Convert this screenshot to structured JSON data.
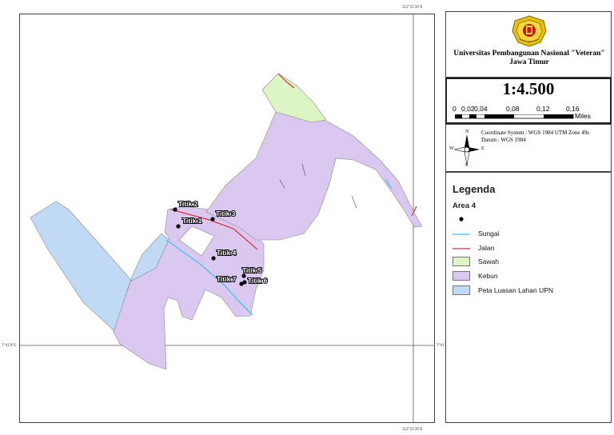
{
  "map": {
    "grat_top": "112°21'30\"E",
    "grat_bottom": "112°21'30\"E",
    "grat_left": "7°41'0\"S",
    "grat_right": "7°41'0\"S",
    "points": [
      "Titik 2",
      "Titik 1",
      "Titik 3",
      "Titik 4",
      "Titik 5",
      "Titik 7",
      "Titik 6"
    ],
    "colors": {
      "kebun": "#dac8f0",
      "sawah": "#ddf4c4",
      "lahan": "#c0d9f5",
      "sungai": "#3ec3e8",
      "jalan": "#d83030"
    }
  },
  "header": {
    "logo": "upn-logo-icon",
    "title_line1": "Universitas Pembangunan Nasional \"Veteran\"",
    "title_line2": "Jawa Timur"
  },
  "scale": {
    "ratio": "1:4.500",
    "ticks": [
      "0",
      "0,02",
      "0,04",
      "0,08",
      "0,12",
      "0,16"
    ],
    "unit": "Miles"
  },
  "info": {
    "north_arrow": "compass-icon",
    "compass_n": "N",
    "compass_s": "S",
    "compass_w": "W",
    "compass_e": "E",
    "coordinate_system": "Coordinate System : WGS 1984 UTM Zone 49s",
    "datum": "Datum : WGS 1984"
  },
  "legend": {
    "title": "Legenda",
    "subtitle": "Area 4",
    "items": [
      {
        "label": ""
      },
      {
        "label": "Sungai"
      },
      {
        "label": "Jalan"
      },
      {
        "label": "Sawah"
      },
      {
        "label": "Kebun"
      },
      {
        "label": "Peta Luasan Lahan UPN"
      }
    ]
  }
}
